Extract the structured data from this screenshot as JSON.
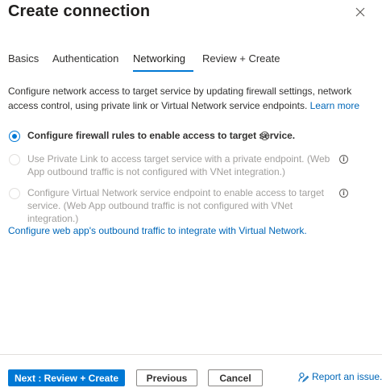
{
  "header": {
    "title": "Create connection",
    "close_icon": "close-icon"
  },
  "tabs": [
    {
      "label": "Basics",
      "active": false
    },
    {
      "label": "Authentication",
      "active": false
    },
    {
      "label": "Networking",
      "active": true
    },
    {
      "label": "Review + Create",
      "active": false
    }
  ],
  "description": {
    "text": "Configure network access to target service by updating firewall settings, network access control, using private link or Virtual Network service endpoints.",
    "learn_more": "Learn more"
  },
  "options": [
    {
      "label": "Configure firewall rules to enable access to target service.",
      "checked": true,
      "disabled": false
    },
    {
      "label": "Use Private Link to access target service with a private endpoint. (Web App outbound traffic is not configured with VNet integration.)",
      "checked": false,
      "disabled": true
    },
    {
      "label": "Configure Virtual Network service endpoint to enable access to target service. (Web App outbound traffic is not configured with VNet integration.)",
      "checked": false,
      "disabled": true
    }
  ],
  "outbound_link": "Configure web app's outbound traffic to integrate with Virtual Network.",
  "footer": {
    "next_label": "Next : Review + Create",
    "previous_label": "Previous",
    "cancel_label": "Cancel",
    "report_label": "Report an issue."
  },
  "colors": {
    "accent": "#0078d4",
    "link": "#0067b8",
    "disabled_text": "#a19f9d"
  }
}
